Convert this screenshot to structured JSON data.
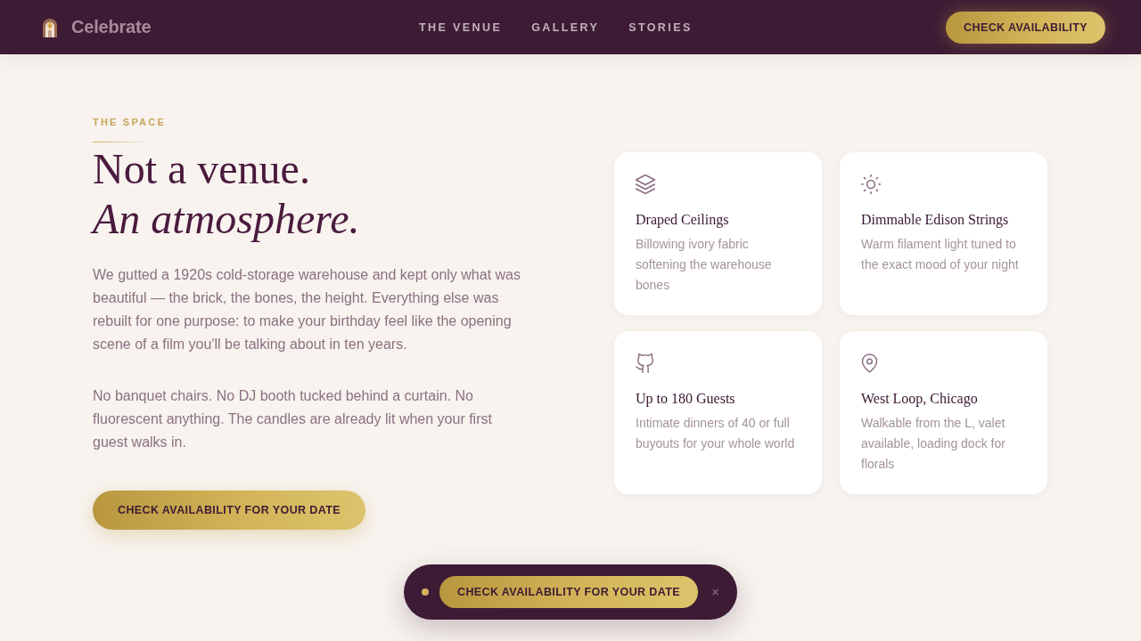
{
  "header": {
    "logo": "Celebrate",
    "nav": [
      "THE VENUE",
      "GALLERY",
      "STORIES"
    ],
    "cta": "CHECK AVAILABILITY"
  },
  "intro": {
    "eyebrow": "THE SPACE",
    "heading": [
      {
        "text": "Not a venue.",
        "italic": false
      },
      {
        "text": "An atmosphere.",
        "italic": true
      }
    ],
    "paragraphs": [
      "We gutted a 1920s cold-storage warehouse and kept only what was beautiful — the brick, the bones, the height. Everything else was rebuilt for one purpose: to make your birthday feel like the opening scene of a film you'll be talking about in ten years.",
      "No banquet chairs. No DJ booth tucked behind a curtain. No fluorescent anything. The candles are already lit when your first guest walks in."
    ],
    "cta": "CHECK AVAILABILITY FOR YOUR DATE"
  },
  "features": [
    {
      "kind": "layers",
      "title": "Draped Ceilings",
      "description": "Billowing ivory fabric softening the warehouse bones"
    },
    {
      "kind": "sun",
      "title": "Dimmable Edison Strings",
      "description": "Warm filament light tuned to the exact mood of your night"
    },
    {
      "kind": "cat",
      "title": "Up to 180 Guests",
      "description": "Intimate dinners of 40 or full buyouts for your whole world"
    },
    {
      "kind": "pin",
      "title": "West Loop, Chicago",
      "description": "Walkable from the L, valet available, loading dock for florals"
    }
  ],
  "floating_bar": {
    "cta": "CHECK AVAILABILITY FOR YOUR DATE",
    "close": "×"
  }
}
